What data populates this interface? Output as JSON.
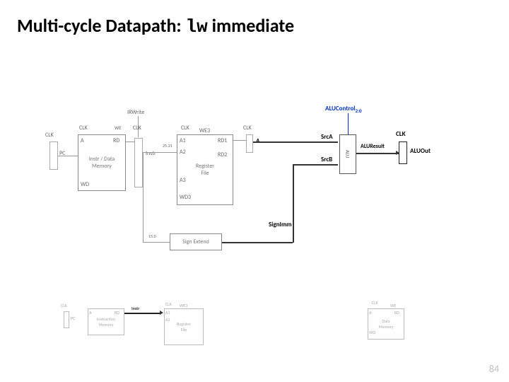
{
  "title": {
    "prefix": "Multi-cycle Datapath: ",
    "mono": "lw",
    "suffix": " immediate"
  },
  "page_number": "84",
  "labels": {
    "irwrite": "IRWrite",
    "clk": "CLK",
    "pc": "PC",
    "instr": "Instr",
    "instr_data_mem": "Instr / Data\nMemory",
    "reg_file": "Register\nFile",
    "sign_extend": "Sign Extend",
    "sign_imm": "SignImm",
    "a": "A",
    "a1": "A1",
    "a2": "A2",
    "a3": "A3",
    "rd": "RD",
    "rd1": "RD1",
    "rd2": "RD2",
    "we3": "WE3",
    "wd": "WD",
    "wd3": "WD3",
    "alucontrol": "ALUControl",
    "alucontrol_sub": "2:0",
    "srca": "SrcA",
    "srcb": "SrcB",
    "alu": "ALU",
    "aluresult": "ALUResult",
    "aluout": "ALUOut",
    "bus2521": "25:21",
    "bus150": "15:0"
  },
  "mini": {
    "clk": "CLK",
    "pc": "PC",
    "instr": "Instr",
    "instr_mem": "Instruction\nMemory",
    "reg_file": "Register\nFile",
    "data_mem": "Data\nMemory",
    "we": "WE",
    "a": "A",
    "rd": "RD",
    "wd": "WD",
    "a1": "A1",
    "a2": "A2",
    "we3": "WE3"
  }
}
